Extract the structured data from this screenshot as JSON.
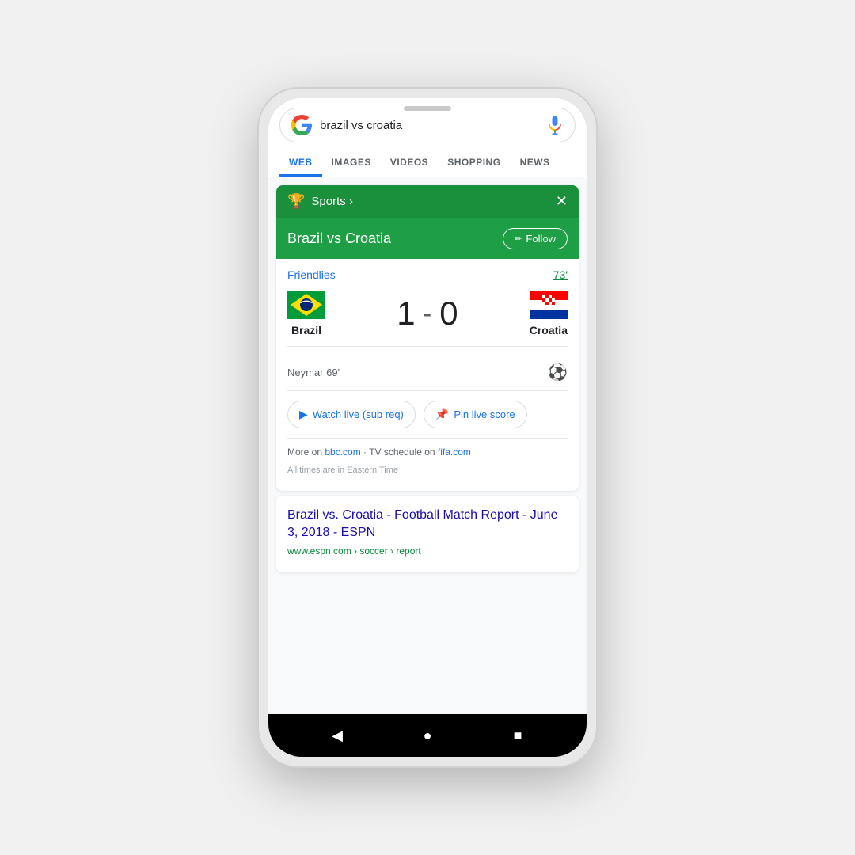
{
  "phone": {
    "speaker": true
  },
  "search": {
    "query": "brazil vs croatia",
    "tabs": [
      "WEB",
      "IMAGES",
      "VIDEOS",
      "SHOPPING",
      "NEWS"
    ],
    "active_tab": "WEB"
  },
  "sports_card": {
    "header_label": "Sports ›",
    "close_label": "✕",
    "match_title": "Brazil vs Croatia",
    "follow_label": "Follow",
    "match_category": "Friendlies",
    "match_time": "73'",
    "team_home": "Brazil",
    "team_away": "Croatia",
    "score_home": "1",
    "score_separator": "-",
    "score_away": "0",
    "scorer": "Neymar 69'",
    "watch_btn": "Watch live (sub req)",
    "pin_btn": "Pin live score",
    "more_text_prefix": "More on ",
    "more_link1": "bbc.com",
    "more_text_mid": " · TV schedule on ",
    "more_link2": "fifa.com",
    "timezone_note": "All times are in Eastern Time"
  },
  "search_result": {
    "title": "Brazil vs. Croatia - Football Match Report - June 3, 2018 - ESPN",
    "url": "www.espn.com › soccer › report"
  },
  "android_nav": {
    "back": "◀",
    "home": "●",
    "recent": "■"
  }
}
